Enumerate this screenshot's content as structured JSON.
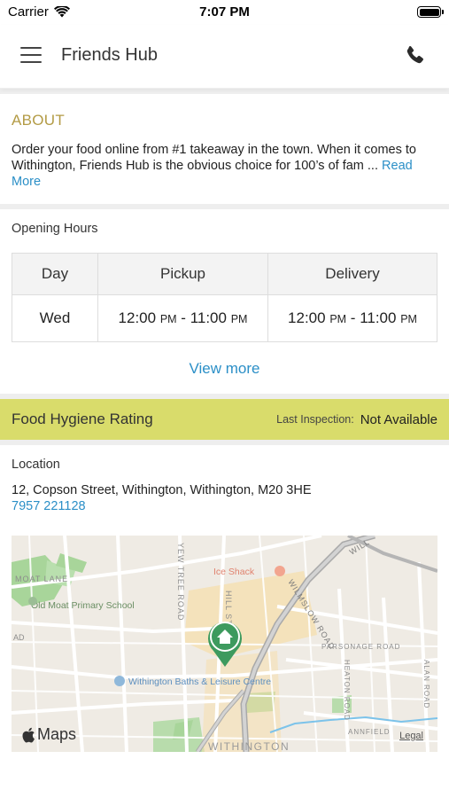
{
  "status_bar": {
    "carrier": "Carrier",
    "time": "7:07 PM"
  },
  "header": {
    "title": "Friends Hub"
  },
  "about": {
    "heading": "ABOUT",
    "text": "Order your food online from #1 takeaway in the town. When it comes to Withington, Friends Hub is the obvious choice for 100’s of fam ...",
    "read_more": "Read More"
  },
  "opening_hours": {
    "label": "Opening Hours",
    "columns": [
      "Day",
      "Pickup",
      "Delivery"
    ],
    "rows": [
      {
        "day": "Wed",
        "pickup": {
          "open": "12:00",
          "open_period": "PM",
          "sep": " - ",
          "close": "11:00",
          "close_period": "PM"
        },
        "delivery": {
          "open": "12:00",
          "open_period": "PM",
          "sep": " - ",
          "close": "11:00",
          "close_period": "PM"
        }
      }
    ],
    "view_more": "View more"
  },
  "hygiene": {
    "title": "Food Hygiene Rating",
    "inspection_label": "Last Inspection:",
    "inspection_value": "Not Available"
  },
  "location": {
    "label": "Location",
    "address": "12, Copson Street, Withington, Withington, M20 3HE",
    "phone": "7957 221128"
  },
  "map": {
    "labels": {
      "road_1": "YEW TREE ROAD",
      "road_2": "HILL ST",
      "road_3": "WILMSLOW ROAD",
      "road_4": "PARSONAGE ROAD",
      "road_5": "HEATON ROAD",
      "road_6": "ALAN ROAD",
      "road_7": "MOAT LANE",
      "road_8": "WILL",
      "school": "Old Moat Primary School",
      "shop": "Ice Shack",
      "baths": "Withington Baths & Leisure Centre",
      "district": "WITHINGTON",
      "annfield": "ANNFIELD",
      "road_ad": "AD"
    },
    "brand": "Maps",
    "legal": "Legal"
  },
  "colors": {
    "accent_gold": "#b39b45",
    "link_blue": "#2b8fc7",
    "hygiene_bar": "#d9dc6b",
    "pin_green": "#3d9a5e"
  },
  "icons": [
    "wifi-icon",
    "battery-icon",
    "menu-icon",
    "phone-icon",
    "home-pin-icon",
    "apple-logo-icon"
  ]
}
